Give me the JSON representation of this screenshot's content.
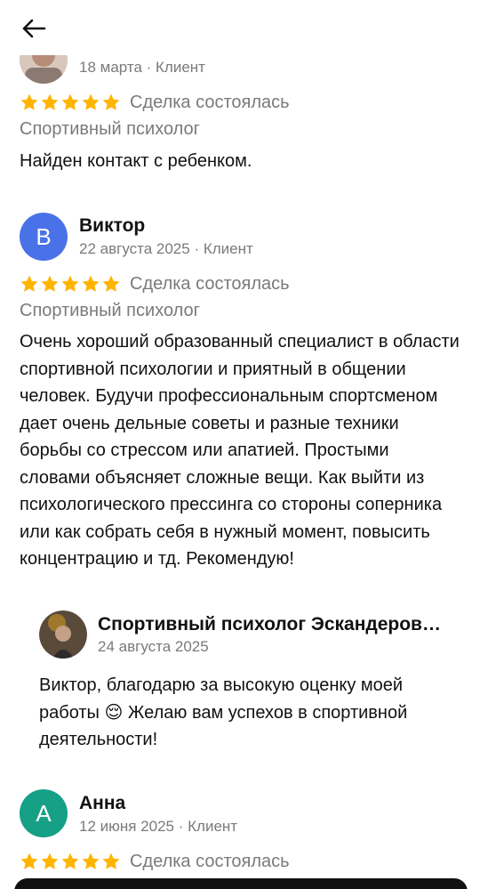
{
  "nav": {
    "back_icon": "arrow-left-icon"
  },
  "reviews": [
    {
      "date": "18 марта",
      "role": "Клиент",
      "rating": 5,
      "deal_status": "Сделка состоялась",
      "service": "Спортивный психолог",
      "text": "Найден контакт с ребенком."
    },
    {
      "avatar_letter": "В",
      "avatar_color": "#4a72e8",
      "name": "Виктор",
      "date": "22 августа 2025",
      "role": "Клиент",
      "rating": 5,
      "deal_status": "Сделка состоялась",
      "service": "Спортивный психолог",
      "text": "Очень хороший образованный специалист в области спортивной психологии и приятный в общении человек. Будучи профессиональным спортсменом дает очень дельные советы и разные техники борьбы со стрессом или апатией. Простыми словами объясняет сложные вещи. Как выйти из психологического прессинга со стороны соперника или как собрать себя в нужный момент, повысить концентрацию и тд. Рекомендую!",
      "reply": {
        "name": "Спортивный психолог Эскандеров…",
        "date": "24 августа 2025",
        "text_before": "Виктор, благодарю за высокую оценку моей работы",
        "emoji": "😌",
        "text_after": "Желаю вам успехов в спортивной деятельности!"
      }
    },
    {
      "avatar_letter": "А",
      "avatar_color": "#16a085",
      "name": "Анна",
      "date": "12 июня 2025",
      "role": "Клиент",
      "rating": 5,
      "deal_status": "Сделка состоялась"
    }
  ],
  "colors": {
    "star": "#ffb400",
    "muted_text": "#7a7a7a"
  }
}
